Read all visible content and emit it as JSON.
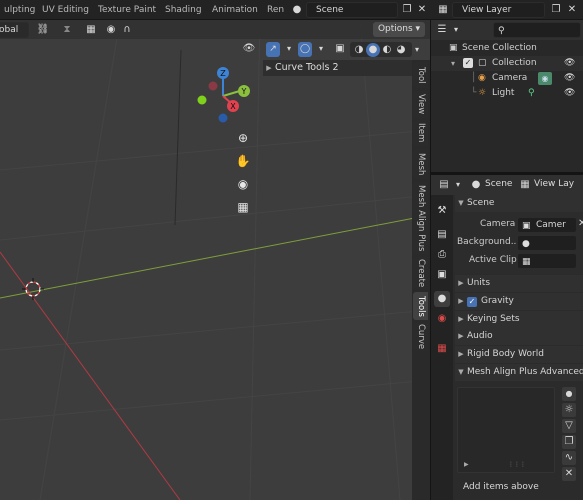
{
  "topbar": {
    "tabs": [
      "ulpting",
      "UV Editing",
      "Texture Paint",
      "Shading",
      "Animation",
      "Ren"
    ],
    "scene_label": "Scene",
    "view_layer_label": "View Layer"
  },
  "viewport": {
    "orientation_value": "obal",
    "options_label": "Options",
    "gizmo_axes": {
      "z": "Z",
      "y": "Y",
      "x": "X"
    },
    "popover_title": "Curve Tools 2"
  },
  "side_tabs": [
    "Tool",
    "View",
    "Item",
    "Mesh",
    "Mesh Align Plus",
    "Create",
    "Tools",
    "Curve"
  ],
  "side_tab_active": "Tools",
  "outliner": {
    "root": "Scene Collection",
    "items": [
      {
        "label": "Collection",
        "icon": "collection-icon"
      },
      {
        "label": "Camera",
        "icon": "camera-icon"
      },
      {
        "label": "Light",
        "icon": "light-icon"
      }
    ]
  },
  "properties": {
    "scene_field": "Scene",
    "view_layer_field": "View Lay",
    "panel_scene": "Scene",
    "camera_label": "Camera",
    "camera_value": "Camer",
    "background_label": "Background..",
    "active_clip_label": "Active Clip",
    "panels": [
      "Units",
      "Gravity",
      "Keying Sets",
      "Audio",
      "Rigid Body World",
      "Mesh Align Plus Advanced"
    ],
    "gravity_checked": true,
    "footer_text": "Add items above"
  },
  "colors": {
    "x_axis": "#e0434f",
    "y_axis": "#8bbf3e",
    "z_axis": "#3d84d6",
    "accent_blue": "#4772b3"
  }
}
